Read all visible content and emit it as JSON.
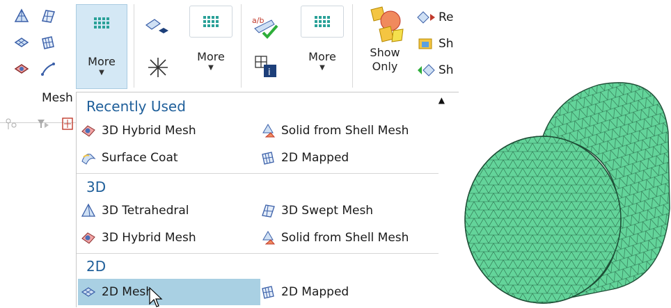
{
  "ribbon": {
    "group_label": "Mesh",
    "more1": {
      "label": "More"
    },
    "more2": {
      "label": "More"
    },
    "more3": {
      "label": "More"
    },
    "show_only": {
      "line1": "Show",
      "line2": "Only"
    },
    "right_items": [
      {
        "label": "Re",
        "icon": "reverse-icon"
      },
      {
        "label": "Sh",
        "icon": "show-icon"
      },
      {
        "label": "Sh",
        "icon": "show-hide-icon"
      }
    ]
  },
  "menu": {
    "sections": [
      {
        "title": "Recently Used"
      },
      {
        "title": "3D"
      },
      {
        "title": "2D"
      }
    ],
    "recent": [
      {
        "label": "3D Hybrid Mesh",
        "icon": "hybrid-mesh-icon"
      },
      {
        "label": "Solid from Shell Mesh",
        "icon": "solid-from-shell-icon"
      },
      {
        "label": "Surface Coat",
        "icon": "surface-coat-icon"
      },
      {
        "label": "2D Mapped",
        "icon": "mapped-mesh-icon"
      }
    ],
    "threed": [
      {
        "label": "3D Tetrahedral",
        "icon": "tetrahedral-icon"
      },
      {
        "label": "3D Swept Mesh",
        "icon": "swept-mesh-icon"
      },
      {
        "label": "3D Hybrid Mesh",
        "icon": "hybrid-mesh-icon"
      },
      {
        "label": "Solid from Shell Mesh",
        "icon": "solid-from-shell-icon"
      }
    ],
    "twod": [
      {
        "label": "2D Mesh",
        "icon": "2d-mesh-icon",
        "highlighted": true
      },
      {
        "label": "2D Mapped",
        "icon": "mapped-mesh-icon"
      }
    ]
  },
  "colors": {
    "mesh_fill": "#63d49a",
    "mesh_line": "#2a6b4a",
    "section_title": "#1f5f9a",
    "highlight": "#a9d0e3"
  }
}
